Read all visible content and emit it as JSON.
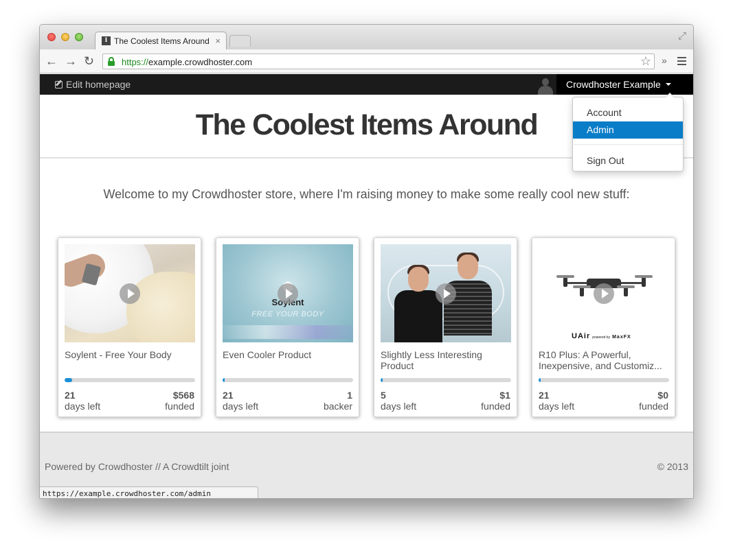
{
  "browser": {
    "tab_title": "The Coolest Items Around",
    "tab_close": "×",
    "favicon": "i",
    "url_scheme": "https://",
    "url_host": "example.crowdhoster.com",
    "back_icon": "←",
    "forward_icon": "→",
    "reload_icon": "↻",
    "star_icon": "☆",
    "extensions_icon": "»",
    "fullscreen_icon": "⤢",
    "status_url": "https://example.crowdhoster.com/admin"
  },
  "navbar": {
    "edit_label": "Edit homepage",
    "user_name": "Crowdhoster Example"
  },
  "dropdown": {
    "items": [
      {
        "label": "Account",
        "active": false
      },
      {
        "label": "Admin",
        "active": true
      },
      {
        "label": "Sign Out",
        "active": false
      }
    ],
    "active_color": "#0a7dc8"
  },
  "page": {
    "title": "The Coolest Items Around",
    "welcome": "Welcome to my Crowdhoster store, where I'm raising money to make some really cool new stuff:"
  },
  "cards": [
    {
      "title": "Soylent - Free Your Body",
      "progress": 0.06,
      "days": "21",
      "days_label": "days left",
      "amount": "$568",
      "amount_label": "funded"
    },
    {
      "title": "Even Cooler Product",
      "progress": 0.015,
      "days": "21",
      "days_label": "days left",
      "amount": "1",
      "amount_label": "backer"
    },
    {
      "title": "Slightly Less Interesting Product",
      "progress": 0.015,
      "days": "5",
      "days_label": "days left",
      "amount": "$1",
      "amount_label": "funded"
    },
    {
      "title": "R10 Plus: A Powerful, Inexpensive, and Customiz...",
      "progress": 0.015,
      "days": "21",
      "days_label": "days left",
      "amount": "$0",
      "amount_label": "funded"
    }
  ],
  "thumb_text": {
    "soylent_logo": "Soylent",
    "soylent_tag": "FREE YOUR BODY",
    "uair_brand": "UAir",
    "uair_powered": "powered by",
    "uair_partner": "MaxFX"
  },
  "footer": {
    "left": "Powered by Crowdhoster // A Crowdtilt joint",
    "right": "© 2013"
  },
  "colors": {
    "accent": "#1a8fd6",
    "navbar": "#1b1b1b"
  }
}
